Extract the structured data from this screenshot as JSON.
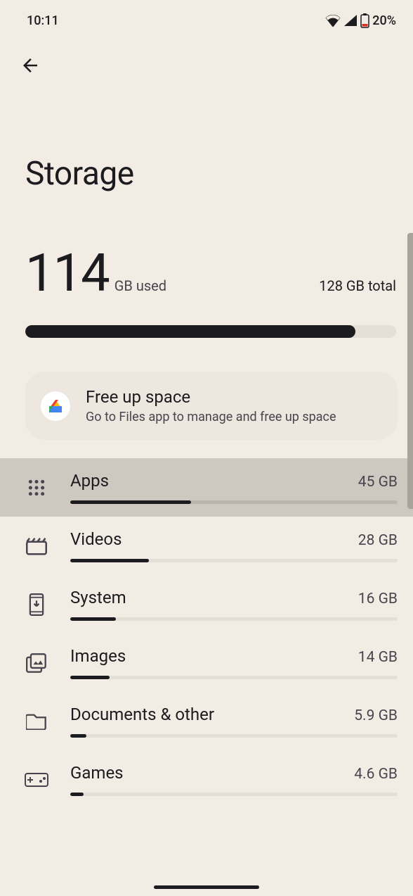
{
  "status": {
    "time": "10:11",
    "battery_pct": "20%"
  },
  "title": "Storage",
  "usage": {
    "used_value": "114",
    "used_unit": "GB used",
    "total": "128 GB total",
    "percent": 89
  },
  "card": {
    "title": "Free up space",
    "subtitle": "Go to Files app to manage and free up space"
  },
  "categories": [
    {
      "name": "Apps",
      "size": "45 GB",
      "percent": 37,
      "icon": "apps",
      "selected": true
    },
    {
      "name": "Videos",
      "size": "28 GB",
      "percent": 24,
      "icon": "movie",
      "selected": false
    },
    {
      "name": "System",
      "size": "16 GB",
      "percent": 14,
      "icon": "system",
      "selected": false
    },
    {
      "name": "Images",
      "size": "14 GB",
      "percent": 12,
      "icon": "images",
      "selected": false
    },
    {
      "name": "Documents & other",
      "size": "5.9 GB",
      "percent": 5,
      "icon": "folder",
      "selected": false
    },
    {
      "name": "Games",
      "size": "4.6 GB",
      "percent": 4,
      "icon": "games",
      "selected": false
    }
  ]
}
